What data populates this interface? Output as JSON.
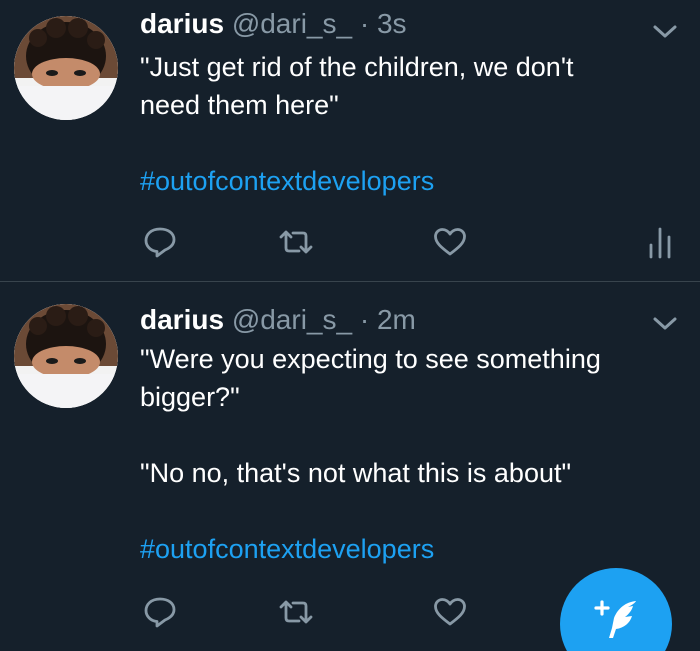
{
  "colors": {
    "background": "#15202b",
    "divider": "#38444d",
    "secondary_text": "#8899a6",
    "accent": "#1da1f2",
    "text": "#ffffff"
  },
  "tweets": [
    {
      "name": "darius",
      "handle": "@dari_s_",
      "dot": "·",
      "time": "3s",
      "lines": [
        "\"Just get rid of the children, we don't",
        "need them here\""
      ],
      "hashtag": "#outofcontextdevelopers",
      "icons": [
        "reply-icon",
        "retweet-icon",
        "like-icon",
        "analytics-icon"
      ]
    },
    {
      "name": "darius",
      "handle": "@dari_s_",
      "dot": "·",
      "time": "2m",
      "lines": [
        "\"Were you expecting to see something",
        "bigger?\""
      ],
      "lines2": [
        "\"No no, that's not what this is about\""
      ],
      "hashtag": "#outofcontextdevelopers",
      "icons": [
        "reply-icon",
        "retweet-icon",
        "like-icon"
      ]
    }
  ],
  "fab": {
    "icon": "compose-tweet-icon"
  }
}
